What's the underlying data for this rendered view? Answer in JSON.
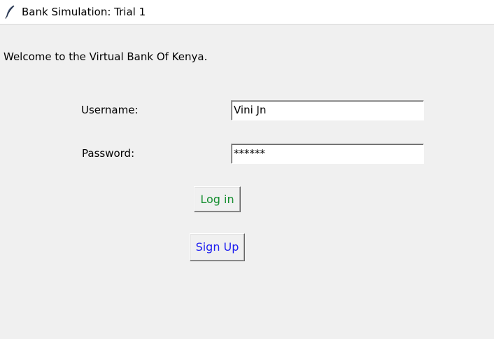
{
  "window": {
    "title": "Bank Simulation: Trial 1",
    "icon": "feather-icon"
  },
  "main": {
    "welcome_text": "Welcome to the Virtual Bank Of Kenya.",
    "username_label": "Username:",
    "username_value": "Vini Jn",
    "password_label": "Password:",
    "password_value": "******",
    "login_label": "Log in",
    "signup_label": "Sign Up"
  },
  "colors": {
    "background": "#f0f0f0",
    "login_text": "#138d2e",
    "signup_text": "#1c1cf0"
  }
}
